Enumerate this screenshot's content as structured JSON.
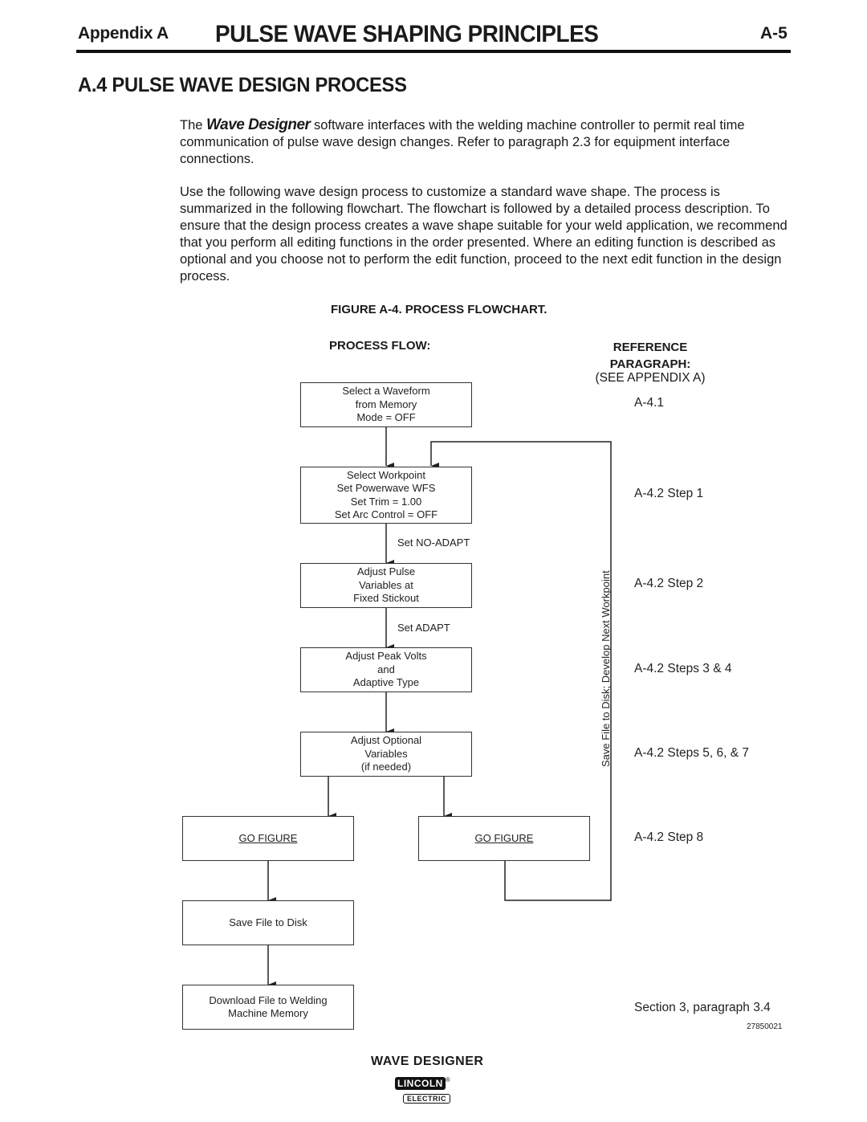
{
  "header": {
    "appendix_label": "Appendix A",
    "title": "PULSE WAVE SHAPING PRINCIPLES",
    "page_number": "A-5"
  },
  "section": {
    "title": "A.4  PULSE WAVE DESIGN PROCESS"
  },
  "paragraphs": {
    "p1_prefix": "The ",
    "p1_brand": "Wave Designer",
    "p1_rest": " software interfaces with the welding machine controller to permit real time communication of pulse wave design changes. Refer to paragraph 2.3 for equipment interface connections.",
    "p2": "Use the following wave design process to customize a standard wave shape. The process is summarized in the following flowchart. The flowchart is followed by a detailed process description. To ensure that the design process creates a wave shape suitable for your weld application, we recommend that you perform all editing functions in the order presented. Where an editing function is described as optional and you choose not to perform the edit function, proceed to the next edit function in the design process."
  },
  "figure": {
    "caption": "FIGURE A-4.  PROCESS FLOWCHART.",
    "process_flow_heading": "PROCESS FLOW:",
    "reference_heading_line1": "REFERENCE",
    "reference_heading_line2": "PARAGRAPH:",
    "reference_subheading": "(SEE APPENDIX A)",
    "boxes": {
      "select_waveform": "Select a Waveform\nfrom Memory\nMode = OFF",
      "select_workpoint": "Select Workpoint\nSet Powerwave WFS\nSet Trim = 1.00\nSet Arc Control = OFF",
      "adjust_pulse": "Adjust Pulse\nVariables at\nFixed Stickout",
      "adjust_peak": "Adjust Peak Volts\nand\nAdaptive Type",
      "adjust_optional": "Adjust Optional\nVariables\n(if needed)",
      "go_figure_left": "GO FIGURE",
      "go_figure_right": "GO FIGURE",
      "save_file": "Save File to Disk",
      "download_file": "Download File to Welding\nMachine Memory"
    },
    "arrow_labels": {
      "no_adapt": "Set NO-ADAPT",
      "adapt": "Set ADAPT",
      "loop": "Save File to Disk; Develop Next Workpoint"
    },
    "references": [
      "A-4.1",
      "A-4.2 Step 1",
      "A-4.2 Step 2",
      "A-4.2 Steps 3 & 4",
      "A-4.2 Steps 5, 6, & 7",
      "A-4.2 Step 8",
      "Section 3, paragraph 3.4"
    ],
    "figure_code": "27850021"
  },
  "footer": {
    "product": "WAVE  DESIGNER",
    "logo_top": "LINCOLN",
    "logo_reg": "®",
    "logo_bottom": "ELECTRIC"
  }
}
